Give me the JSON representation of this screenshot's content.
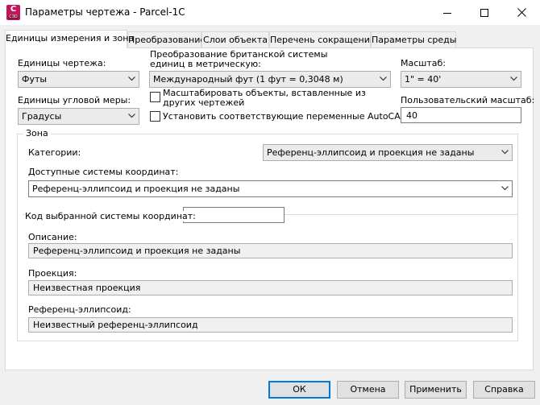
{
  "window": {
    "title": "Параметры чертежа - Parcel-1C",
    "icon_letter": "C",
    "icon_sub": "C3D"
  },
  "tabs": [
    {
      "label": "Единицы измерения и зона",
      "active": true
    },
    {
      "label": "Преобразование",
      "active": false
    },
    {
      "label": "Слои объекта",
      "active": false
    },
    {
      "label": "Перечень сокращений",
      "active": false
    },
    {
      "label": "Параметры среды",
      "active": false
    }
  ],
  "units": {
    "drawing_units_label": "Единицы чертежа:",
    "drawing_units_value": "Футы",
    "angular_units_label": "Единицы угловой меры:",
    "angular_units_value": "Градусы",
    "imperial_label": "Преобразование британской системы единиц в метрическую:",
    "imperial_value": "Международный фут (1 фут = 0,3048 м)",
    "scale_inserted_label": "Масштабировать объекты, вставленные из других чертежей",
    "scale_inserted_checked": false,
    "set_vars_label": "Установить соответствующие переменные AutoCAD",
    "set_vars_checked": false,
    "scale_label": "Масштаб:",
    "scale_value": "1\" = 40'",
    "custom_scale_label": "Пользовательский масштаб:",
    "custom_scale_value": "40"
  },
  "zone": {
    "legend": "Зона",
    "categories_label": "Категории:",
    "categories_value": "Референц-эллипсоид и проекция не заданы",
    "available_label": "Доступные системы координат:",
    "available_value": "Референц-эллипсоид и проекция не заданы",
    "code_label": "Код выбранной системы координат:",
    "code_value": ".",
    "description_label": "Описание:",
    "description_value": "Референц-эллипсоид и проекция не заданы",
    "projection_label": "Проекция:",
    "projection_value": "Неизвестная проекция",
    "ellipsoid_label": "Референц-эллипсоид:",
    "ellipsoid_value": "Неизвестный референц-эллипсоид"
  },
  "buttons": {
    "ok": "ОК",
    "cancel": "Отмена",
    "apply": "Применить",
    "help": "Справка"
  }
}
